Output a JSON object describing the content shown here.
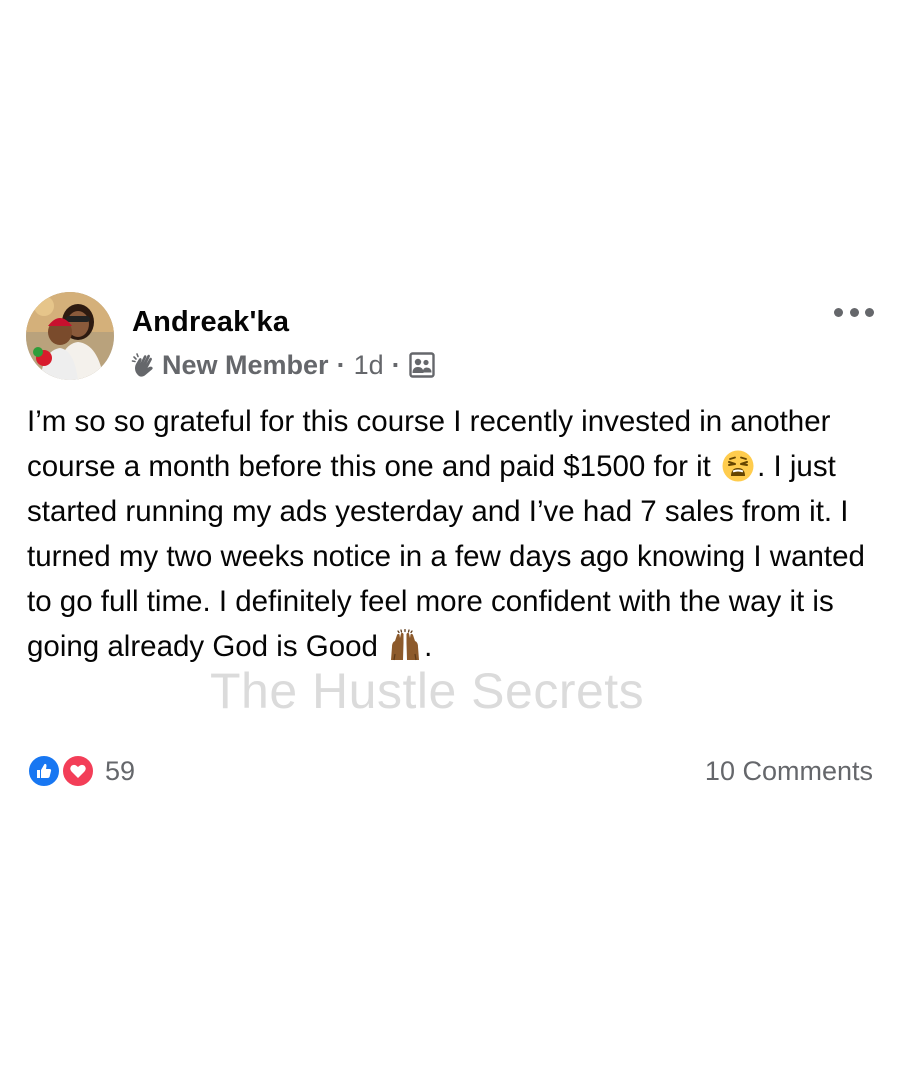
{
  "post": {
    "author": {
      "name": "Andreak'ka",
      "avatar_icon": "profile-photo-avatar"
    },
    "meta": {
      "badge_icon": "waving-hand-icon",
      "badge_label": "New Member",
      "separator": "·",
      "time": "1d",
      "privacy_icon": "group-members-icon"
    },
    "more_icon": "more-options-icon",
    "body": {
      "part1": "I’m so so grateful for this course I recently invested in another course a month before this one and paid $1500 for it ",
      "emoji1": "weary-face-emoji",
      "part2": ". I just started running my ads yesterday and I’ve had 7 sales from it. I turned my two weeks notice in a few days ago knowing I wanted to go full time. I definitely feel more confident with the way it is going already God is Good ",
      "emoji2": "raising-hands-emoji",
      "part3": "."
    },
    "watermark": "The Hustle Secrets",
    "footer": {
      "reaction_icons": [
        "like-icon",
        "love-icon"
      ],
      "reaction_count": "59",
      "comments_label": "10 Comments"
    },
    "colors": {
      "like": "#1877f2",
      "love": "#f33e58",
      "secondary_text": "#65676b"
    }
  }
}
